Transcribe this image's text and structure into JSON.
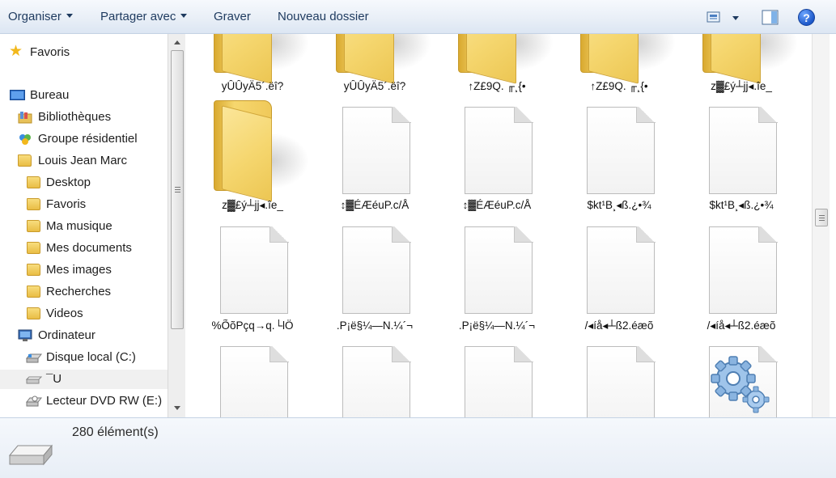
{
  "toolbar": {
    "organize_label": "Organiser",
    "share_label": "Partager avec",
    "burn_label": "Graver",
    "new_folder_label": "Nouveau dossier",
    "help_label": "?"
  },
  "nav": {
    "items": [
      {
        "label": "Favoris",
        "icon": "star-icon"
      },
      {
        "label": "Bureau",
        "icon": "desktop-icon"
      },
      {
        "label": "Bibliothèques",
        "icon": "libraries-icon"
      },
      {
        "label": "Groupe résidentiel",
        "icon": "homegroup-icon"
      },
      {
        "label": "Louis Jean Marc",
        "icon": "user-folder-icon"
      },
      {
        "label": "Desktop",
        "icon": "folder-icon"
      },
      {
        "label": "Favoris",
        "icon": "folder-icon"
      },
      {
        "label": "Ma musique",
        "icon": "folder-icon"
      },
      {
        "label": "Mes documents",
        "icon": "folder-icon"
      },
      {
        "label": "Mes images",
        "icon": "folder-icon"
      },
      {
        "label": "Recherches",
        "icon": "folder-icon"
      },
      {
        "label": "Videos",
        "icon": "folder-icon"
      },
      {
        "label": "Ordinateur",
        "icon": "computer-icon"
      },
      {
        "label": "Disque local (C:)",
        "icon": "hard-drive-icon"
      },
      {
        "label": "¯U",
        "icon": "removable-drive-icon"
      },
      {
        "label": "Lecteur DVD RW (E:)",
        "icon": "dvd-drive-icon"
      }
    ]
  },
  "files": [
    {
      "label": "yÛÛyÄ5´.ëî?",
      "type": "folder"
    },
    {
      "label": "yÛÛyÄ5´.ëî?",
      "type": "folder"
    },
    {
      "label": "↑Z£9Q. ╓¸{•",
      "type": "folder"
    },
    {
      "label": "↑Z£9Q. ╓¸{•",
      "type": "folder"
    },
    {
      "label": "z▓£ý┴jj◂.îe_",
      "type": "folder"
    },
    {
      "label": "z▓£ý┴jj◂.îe_",
      "type": "folder"
    },
    {
      "label": "↕▓ÉÆéuP.c/Å",
      "type": "file"
    },
    {
      "label": "↕▓ÉÆéuP.c/Å",
      "type": "file"
    },
    {
      "label": "$kt¹B¸◂ß.¿•¾",
      "type": "file"
    },
    {
      "label": "$kt¹B¸◂ß.¿•¾",
      "type": "file"
    },
    {
      "label": "%ÕõPçq→q.└lÖ",
      "type": "file"
    },
    {
      "label": ".P¡ë§¼—N.¼´¬",
      "type": "file"
    },
    {
      "label": ".P¡ë§¼—N.¼´¬",
      "type": "file"
    },
    {
      "label": "/◂íå◂┴ß2.éæõ",
      "type": "file"
    },
    {
      "label": "/◂íå◂┴ß2.éæõ",
      "type": "file"
    },
    {
      "label": "",
      "type": "file"
    },
    {
      "label": "",
      "type": "file"
    },
    {
      "label": "",
      "type": "file"
    },
    {
      "label": "",
      "type": "file"
    },
    {
      "label": "",
      "type": "settings-file"
    }
  ],
  "details": {
    "count": "280 élément(s)"
  }
}
